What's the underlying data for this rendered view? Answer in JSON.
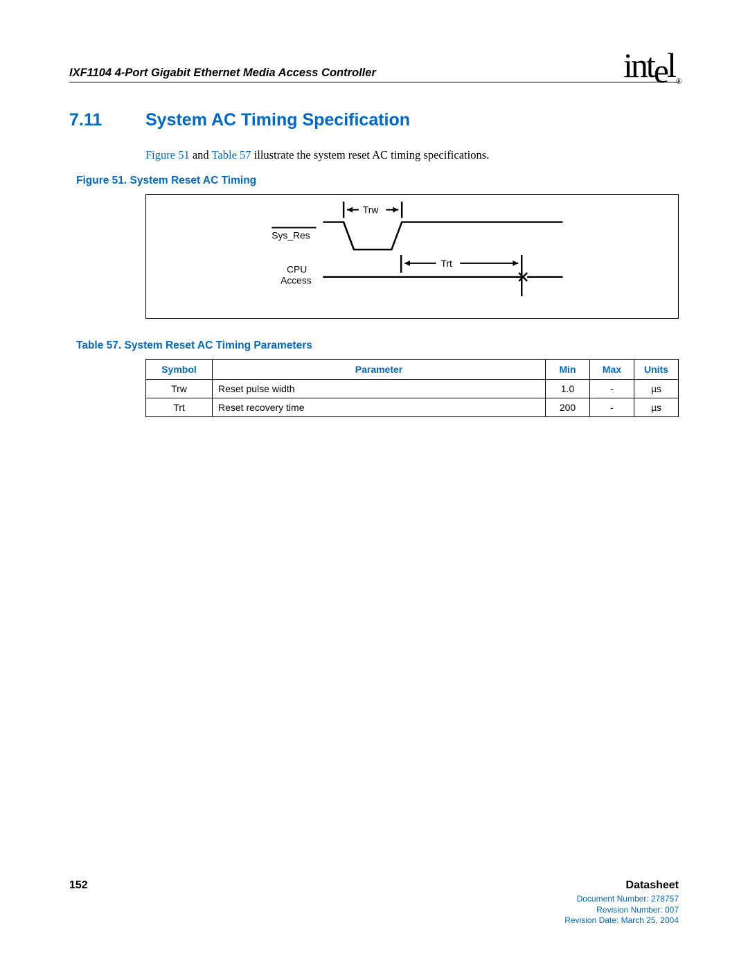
{
  "header": {
    "doc_title": "IXF1104 4-Port Gigabit Ethernet Media Access Controller",
    "logo_text": "intel",
    "logo_reg": "®"
  },
  "section": {
    "number": "7.11",
    "title": "System AC Timing Specification"
  },
  "body": {
    "ref_figure": "Figure 51",
    "and": " and ",
    "ref_table": "Table 57",
    "rest": " illustrate the system reset AC timing specifications."
  },
  "figure": {
    "caption": "Figure 51. System Reset AC Timing",
    "label_trw": "Trw",
    "label_sysres": "Sys_Res",
    "label_trt": "Trt",
    "label_cpu": "CPU",
    "label_access": "Access"
  },
  "table": {
    "caption": "Table 57.  System Reset AC Timing Parameters",
    "headers": {
      "symbol": "Symbol",
      "parameter": "Parameter",
      "min": "Min",
      "max": "Max",
      "units": "Units"
    },
    "rows": [
      {
        "symbol": "Trw",
        "parameter": "Reset pulse width",
        "min": "1.0",
        "max": "-",
        "units": "µs"
      },
      {
        "symbol": "Trt",
        "parameter": "Reset recovery time",
        "min": "200",
        "max": "-",
        "units": "µs"
      }
    ]
  },
  "footer": {
    "page": "152",
    "type": "Datasheet",
    "docnum": "Document Number: 278757",
    "revnum": "Revision Number: 007",
    "revdate": "Revision Date: March 25, 2004"
  }
}
